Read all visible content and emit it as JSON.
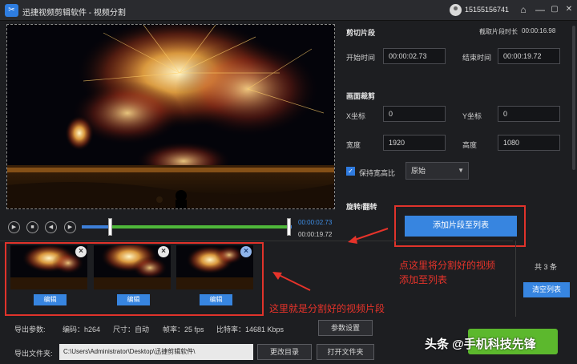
{
  "app": {
    "title": "迅捷视频剪辑软件 - 视频分割",
    "logo_glyph": "✂",
    "user_id": "15155156741"
  },
  "window_controls": {
    "home": "⌂",
    "minimize": "—",
    "maximize": "▢",
    "close": "✕"
  },
  "player": {
    "current_time": "00:00:02.73",
    "end_time": "00:00:19.72",
    "selection_start_fraction": 0.139,
    "selection_end_fraction": 1.0
  },
  "cut": {
    "section_title": "剪切片段",
    "duration_label": "截取片段时长",
    "duration_value": "00:00:16.98",
    "start_label": "开始时间",
    "start_value": "00:00:02.73",
    "end_label": "结束时间",
    "end_value": "00:00:19.72"
  },
  "crop": {
    "section_title": "画面裁剪",
    "x_label": "X坐标",
    "x_value": "0",
    "y_label": "Y坐标",
    "y_value": "0",
    "width_label": "宽度",
    "width_value": "1920",
    "height_label": "高度",
    "height_value": "1080",
    "keep_ratio_label": "保持宽高比",
    "ratio_value": "原始"
  },
  "rotate": {
    "section_title": "旋转/翻转"
  },
  "add_button": "添加片段至列表",
  "clips": {
    "edit_label": "编辑",
    "count_text": "共 3 条"
  },
  "clear_button": "清空列表",
  "annotations": {
    "add_note_line1": "点这里将分割好的视频",
    "add_note_line2": "添加至列表",
    "clips_note": "这里就是分割好的视频片段"
  },
  "export": {
    "params_label": "导出参数:",
    "codec": "编码：h264",
    "size": "尺寸：自动",
    "fps": "帧率：25 fps",
    "bitrate": "比特率：14681 Kbps",
    "settings_button": "参数设置",
    "folder_label": "导出文件夹:",
    "folder_path": "C:\\Users\\Administrator\\Desktop\\迅捷剪辑软件\\",
    "change_dir_button": "更改目录",
    "open_folder_button": "打开文件夹"
  },
  "watermark": "头条 @手机科技先锋",
  "colors": {
    "accent": "#3785e0",
    "timeline_selected": "#4fb83a",
    "annotation": "#e6332a"
  }
}
